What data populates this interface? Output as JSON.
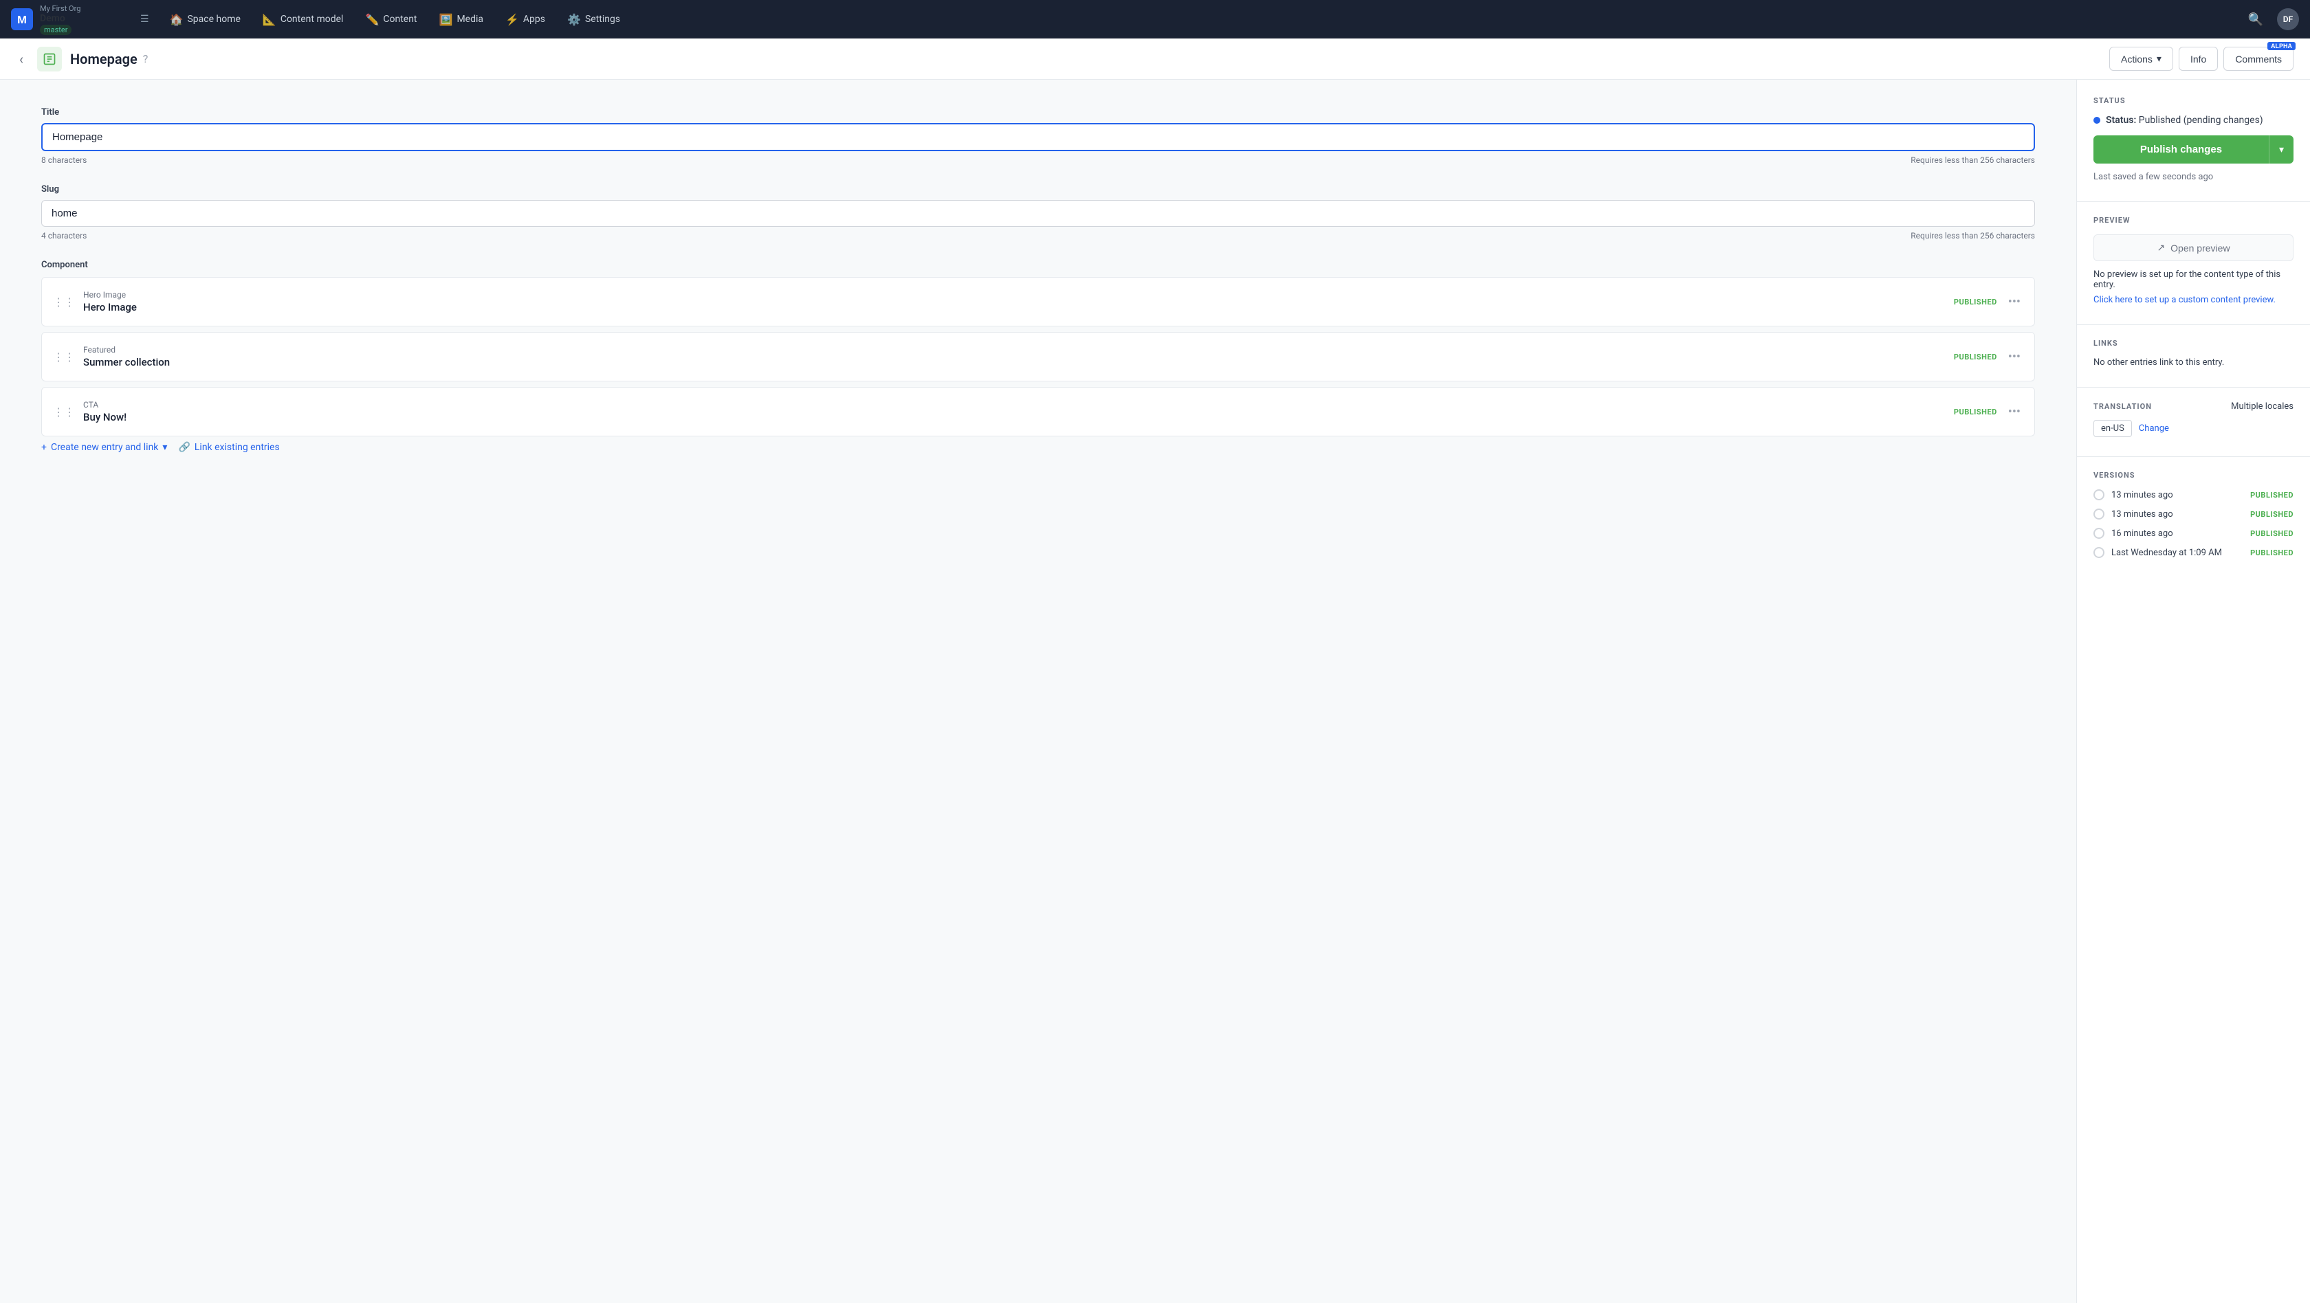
{
  "org": {
    "name": "My First Org",
    "space": "Demo",
    "branch": "master"
  },
  "nav": {
    "links": [
      {
        "id": "space-home",
        "label": "Space home",
        "icon": "🏠",
        "active": false
      },
      {
        "id": "content-model",
        "label": "Content model",
        "icon": "📐",
        "active": false
      },
      {
        "id": "content",
        "label": "Content",
        "icon": "✏️",
        "active": false
      },
      {
        "id": "media",
        "label": "Media",
        "icon": "🖼️",
        "active": false
      },
      {
        "id": "apps",
        "label": "Apps",
        "icon": "⚡",
        "active": false
      },
      {
        "id": "settings",
        "label": "Settings",
        "icon": "⚙️",
        "active": false
      }
    ],
    "avatar": "DF"
  },
  "entry": {
    "title": "Homepage",
    "icon_color": "#e8f5e9"
  },
  "header_buttons": {
    "actions_label": "Actions",
    "info_label": "Info",
    "comments_label": "Comments",
    "alpha_badge": "ALPHA"
  },
  "fields": {
    "title_label": "Title",
    "title_value": "Homepage",
    "title_chars": "8 characters",
    "title_limit": "Requires less than 256 characters",
    "slug_label": "Slug",
    "slug_value": "home",
    "slug_chars": "4 characters",
    "slug_limit": "Requires less than 256 characters",
    "component_label": "Component"
  },
  "components": [
    {
      "type": "Hero Image",
      "name": "Hero Image",
      "status": "PUBLISHED"
    },
    {
      "type": "Featured",
      "name": "Summer collection",
      "status": "PUBLISHED"
    },
    {
      "type": "CTA",
      "name": "Buy Now!",
      "status": "PUBLISHED"
    }
  ],
  "add_links": {
    "create_label": "Create new entry and link",
    "link_label": "Link existing entries"
  },
  "sidebar": {
    "status_section": "STATUS",
    "status_label": "Status:",
    "status_value": "Published (pending changes)",
    "publish_label": "Publish changes",
    "last_saved": "Last saved a few seconds ago",
    "preview_section": "PREVIEW",
    "open_preview_label": "Open preview",
    "preview_note": "No preview is set up for the content type of this entry.",
    "preview_link": "Click here to set up a custom content preview.",
    "links_section": "LINKS",
    "links_note": "No other entries link to this entry.",
    "translation_section": "TRANSLATION",
    "translation_value": "Multiple locales",
    "locale_badge": "en-US",
    "change_label": "Change",
    "versions_section": "VERSIONS",
    "versions": [
      {
        "time": "13 minutes ago",
        "status": "PUBLISHED"
      },
      {
        "time": "13 minutes ago",
        "status": "PUBLISHED"
      },
      {
        "time": "16 minutes ago",
        "status": "PUBLISHED"
      },
      {
        "time": "Last Wednesday at 1:09 AM",
        "status": "PUBLISHED"
      }
    ]
  }
}
